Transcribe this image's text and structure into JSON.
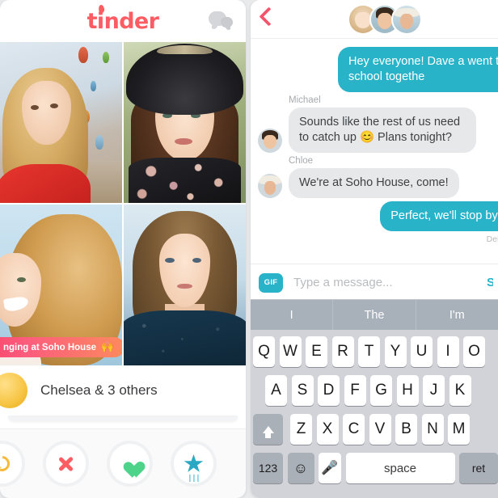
{
  "left": {
    "logo_text": "tinder",
    "logo_color": "#fd5c63",
    "chat_icon_name": "chat-bubbles-icon",
    "status_badge": {
      "text": "nging at Soho House",
      "full_text": "Hanging at Soho House",
      "emoji": "🙌"
    },
    "match": {
      "name": "Chelsea & 3 others"
    },
    "actions": [
      {
        "name": "rewind",
        "color": "#f6b93b"
      },
      {
        "name": "nope",
        "color": "#fd5c63"
      },
      {
        "name": "like",
        "color": "#4ed38a"
      },
      {
        "name": "superlike",
        "color": "#2aa8c4"
      }
    ],
    "photos": [
      {
        "name": "photo-blonde-balloons"
      },
      {
        "name": "photo-hat-floral"
      },
      {
        "name": "photo-curly-beach"
      },
      {
        "name": "photo-navy-sweater"
      }
    ]
  },
  "right": {
    "back_label": "",
    "accent_color": "#29b3c9",
    "header_avatars": [
      "avatar-chloe",
      "avatar-michael",
      "avatar-hat"
    ],
    "messages": [
      {
        "sender": "",
        "direction": "out",
        "text": "Hey everyone! Dave a went to school togethe"
      },
      {
        "sender": "Michael",
        "direction": "in",
        "text": "Sounds like the rest of us need to catch up 😊 Plans tonight?"
      },
      {
        "sender": "Chloe",
        "direction": "in",
        "text": "We're at Soho House, come!"
      },
      {
        "sender": "",
        "direction": "out",
        "text": "Perfect, we'll stop by s"
      }
    ],
    "delivered_label": "Delivered",
    "composer": {
      "gif_label": "GIF",
      "placeholder": "Type a message...",
      "value": "",
      "send_label": "Send"
    },
    "keyboard": {
      "suggestions": [
        "I",
        "The",
        "I'm"
      ],
      "row1": [
        "Q",
        "W",
        "E",
        "R",
        "T",
        "Y",
        "U",
        "I",
        "O"
      ],
      "row2": [
        "A",
        "S",
        "D",
        "F",
        "G",
        "H",
        "J",
        "K"
      ],
      "row3": [
        "Z",
        "X",
        "C",
        "V",
        "B",
        "N",
        "M"
      ],
      "shift_label": "",
      "numbers_label": "123",
      "emoji_label": "☺",
      "mic_label": "🎤",
      "space_label": "space",
      "return_label": "ret"
    }
  }
}
